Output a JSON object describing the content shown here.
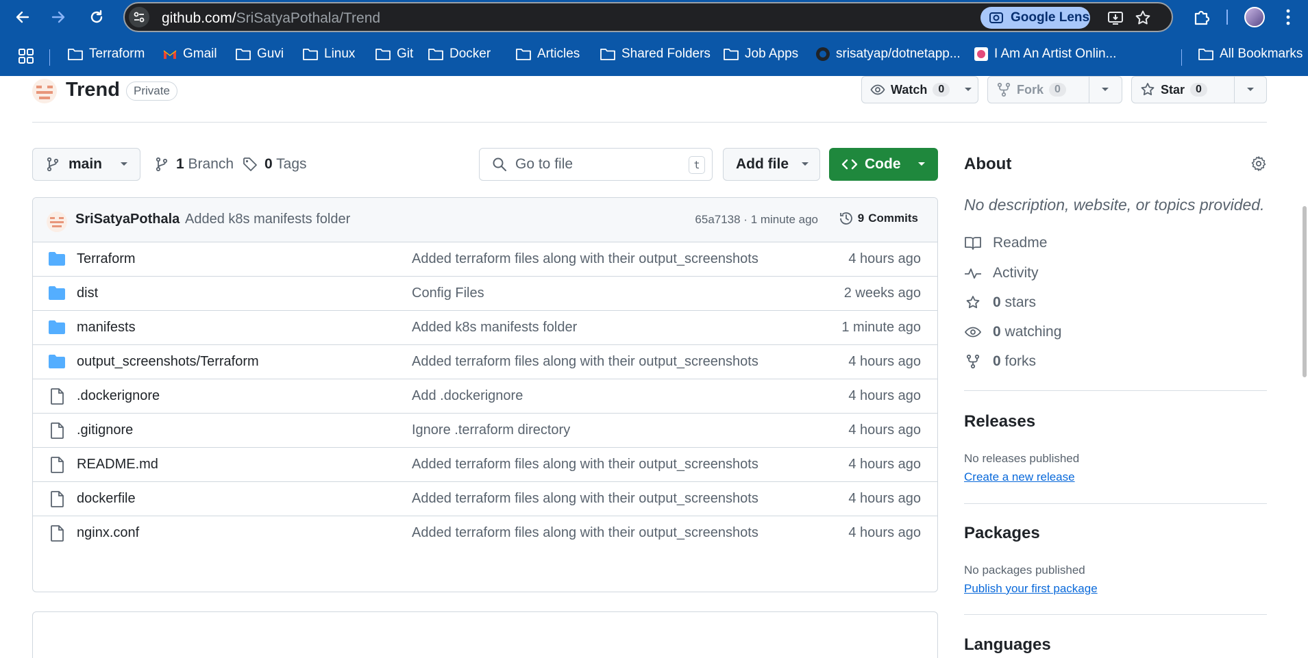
{
  "browser": {
    "url_host": "github.com/",
    "url_path": "SriSatyaPothala/Trend",
    "lens_label": "Google Lens",
    "bookmarks": [
      {
        "label": "Terraform",
        "icon": "folder-icon"
      },
      {
        "label": "Gmail",
        "icon": "gmail-icon"
      },
      {
        "label": "Guvi",
        "icon": "folder-icon"
      },
      {
        "label": "Linux",
        "icon": "folder-icon"
      },
      {
        "label": "Git",
        "icon": "folder-icon"
      },
      {
        "label": "Docker",
        "icon": "folder-icon"
      },
      {
        "label": "Articles",
        "icon": "folder-icon"
      },
      {
        "label": "Shared Folders",
        "icon": "folder-icon"
      },
      {
        "label": "Job Apps",
        "icon": "folder-icon"
      },
      {
        "label": "srisatyap/dotnetapp...",
        "icon": "github-icon"
      },
      {
        "label": "I Am An Artist Onlin...",
        "icon": "site-icon"
      }
    ],
    "all_bookmarks": "All Bookmarks"
  },
  "repo": {
    "name": "Trend",
    "visibility": "Private",
    "watch_label": "Watch",
    "watch_count": "0",
    "fork_label": "Fork",
    "fork_count": "0",
    "star_label": "Star",
    "star_count": "0"
  },
  "toolbar": {
    "branch": "main",
    "branches_count": "1",
    "branches_label": "Branch",
    "tags_count": "0",
    "tags_label": "Tags",
    "search_placeholder": "Go to file",
    "search_key": "t",
    "add_file": "Add file",
    "code": "Code"
  },
  "commit": {
    "author": "SriSatyaPothala",
    "message": "Added k8s manifests folder",
    "meta": "65a7138 · 1 minute ago",
    "commits_count": "9",
    "commits_label": "Commits"
  },
  "files": [
    {
      "type": "dir",
      "name": "Terraform",
      "message": "Added terraform files along with their output_screenshots",
      "date": "4 hours ago"
    },
    {
      "type": "dir",
      "name": "dist",
      "message": "Config Files",
      "date": "2 weeks ago"
    },
    {
      "type": "dir",
      "name": "manifests",
      "message": "Added k8s manifests folder",
      "date": "1 minute ago"
    },
    {
      "type": "dir",
      "name": "output_screenshots/Terraform",
      "message": "Added terraform files along with their output_screenshots",
      "date": "4 hours ago"
    },
    {
      "type": "file",
      "name": ".dockerignore",
      "message": "Add .dockerignore",
      "date": "4 hours ago"
    },
    {
      "type": "file",
      "name": ".gitignore",
      "message": "Ignore .terraform directory",
      "date": "4 hours ago"
    },
    {
      "type": "file",
      "name": "README.md",
      "message": "Added terraform files along with their output_screenshots",
      "date": "4 hours ago"
    },
    {
      "type": "file",
      "name": "dockerfile",
      "message": "Added terraform files along with their output_screenshots",
      "date": "4 hours ago"
    },
    {
      "type": "file",
      "name": "nginx.conf",
      "message": "Added terraform files along with their output_screenshots",
      "date": "4 hours ago"
    }
  ],
  "sidebar": {
    "about_title": "About",
    "about_desc": "No description, website, or topics provided.",
    "readme": "Readme",
    "activity": "Activity",
    "stars_count": "0",
    "stars_label": "stars",
    "watching_count": "0",
    "watching_label": "watching",
    "forks_count": "0",
    "forks_label": "forks",
    "releases_title": "Releases",
    "releases_none": "No releases published",
    "releases_link": "Create a new release",
    "packages_title": "Packages",
    "packages_none": "No packages published",
    "packages_link": "Publish your first package",
    "languages_title": "Languages"
  },
  "colors": {
    "chrome_blue": "#0b57a8",
    "code_green": "#1f883d",
    "folder_blue": "#54aeff",
    "link_blue": "#0969da"
  }
}
